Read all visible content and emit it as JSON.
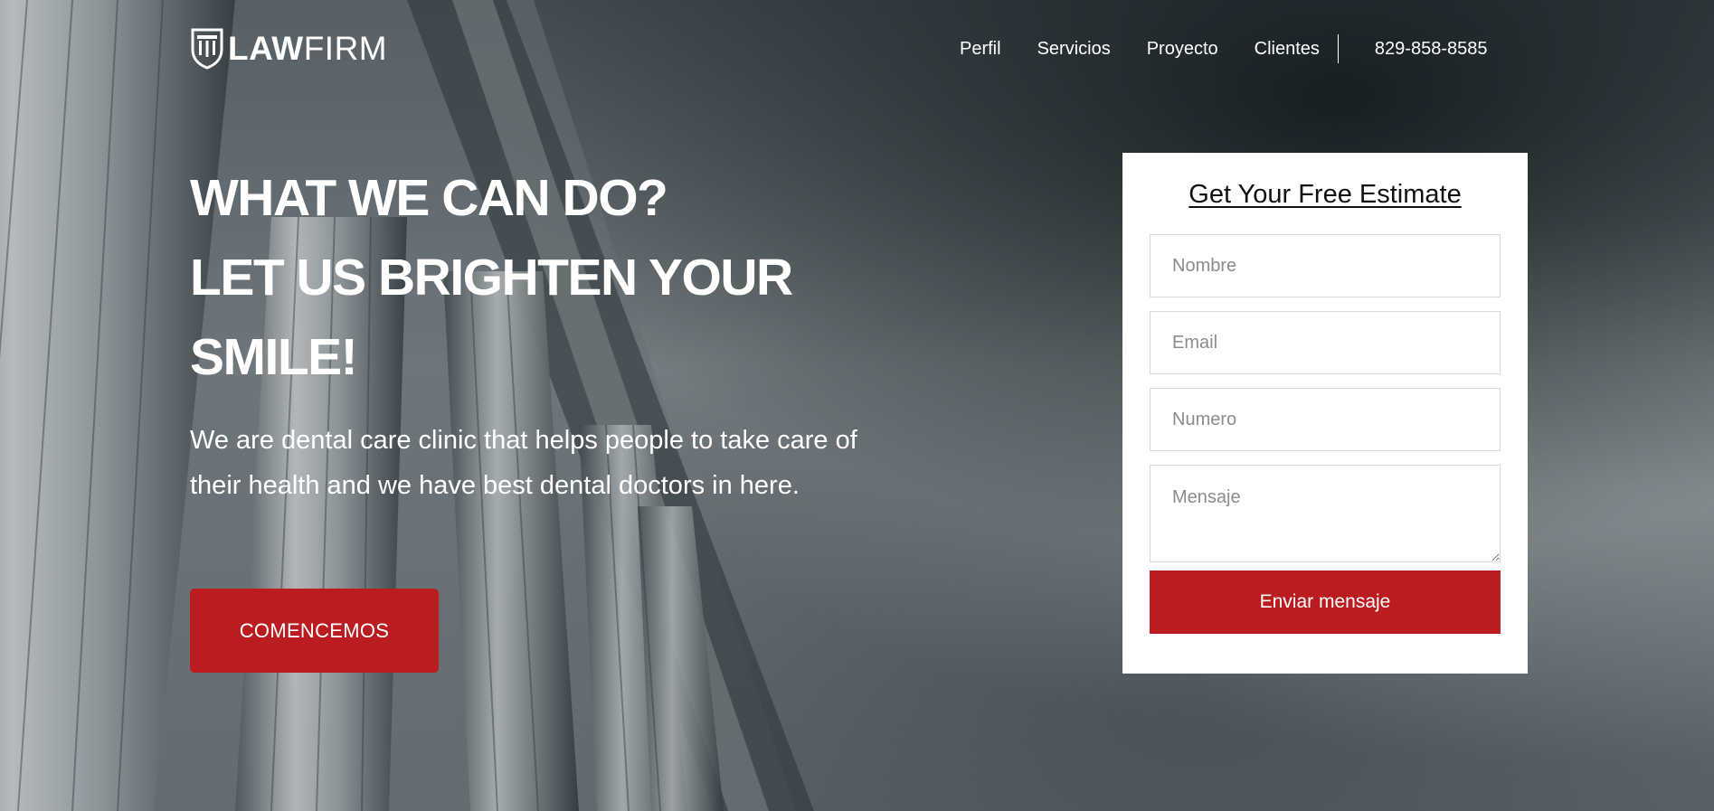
{
  "brand": {
    "logo_bold": "LAW",
    "logo_light": "FIRM"
  },
  "nav": {
    "items": [
      "Perfil",
      "Servicios",
      "Proyecto",
      "Clientes"
    ],
    "phone": "829-858-8585"
  },
  "hero": {
    "headline_line1": "WHAT WE CAN DO?",
    "headline_line2": "LET US BRIGHTEN YOUR SMILE!",
    "lead": "We are dental care clinic that helps people to take care of their health and we have best dental doctors in here.",
    "cta_label": "COMENCEMOS"
  },
  "form": {
    "title": "Get Your Free Estimate",
    "name_placeholder": "Nombre",
    "email_placeholder": "Email",
    "number_placeholder": "Numero",
    "message_placeholder": "Mensaje",
    "submit_label": "Enviar mensaje"
  },
  "colors": {
    "accent": "#bb1c1f",
    "phone": "#c4232a",
    "card_bg": "#ffffff"
  },
  "icons": {
    "logo": "law-firm-shield-icon"
  }
}
